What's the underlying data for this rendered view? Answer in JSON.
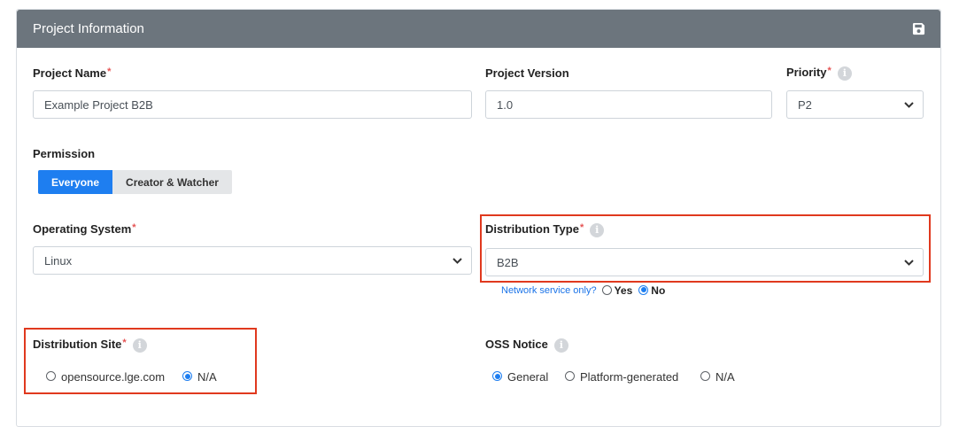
{
  "header": {
    "title": "Project Information",
    "save_icon": "save-icon"
  },
  "required_mark": "*",
  "info_glyph": "i",
  "project_name": {
    "label": "Project Name",
    "value": "Example Project B2B"
  },
  "project_version": {
    "label": "Project Version",
    "value": "1.0"
  },
  "priority": {
    "label": "Priority",
    "value": "P2"
  },
  "permission": {
    "label": "Permission",
    "options": [
      "Everyone",
      "Creator & Watcher"
    ],
    "selected": "Everyone"
  },
  "operating_system": {
    "label": "Operating System",
    "value": "Linux"
  },
  "distribution_type": {
    "label": "Distribution Type",
    "value": "B2B",
    "network_question": "Network service only?",
    "yes": "Yes",
    "no": "No",
    "network_selected": "No"
  },
  "distribution_site": {
    "label": "Distribution Site",
    "options": [
      "opensource.lge.com",
      "N/A"
    ],
    "selected": "N/A"
  },
  "oss_notice": {
    "label": "OSS Notice",
    "options": [
      "General",
      "Platform-generated",
      "N/A"
    ],
    "selected": "General"
  },
  "colors": {
    "header_bg": "#6c757d",
    "accent": "#1e7ef0",
    "highlight": "#e0391e",
    "required": "#e55353"
  }
}
